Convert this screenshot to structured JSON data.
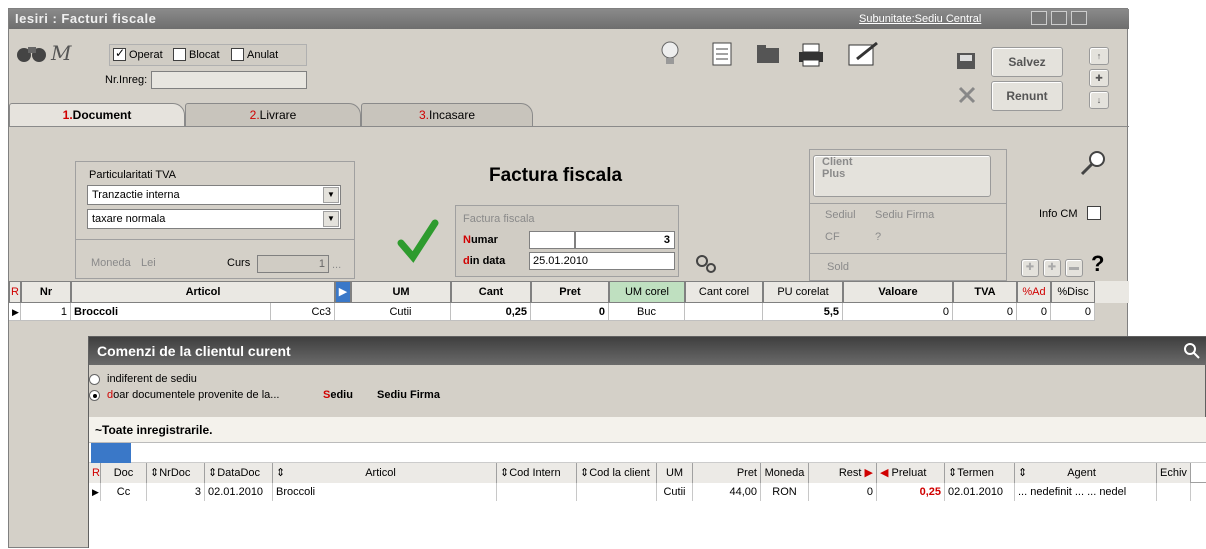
{
  "window": {
    "title": "Iesiri : Facturi fiscale",
    "subunitate": "Subunitate:Sediu Central"
  },
  "toolbar": {
    "m_label": "M",
    "operat_label": "Operat",
    "operat_checked": true,
    "blocat_label": "Blocat",
    "anulat_label": "Anulat",
    "nr_inreg_label": "Nr.Inreg:",
    "nr_inreg_value": "",
    "salvez_label": "Salvez",
    "renunt_label": "Renunt"
  },
  "tabs": [
    {
      "num": "1.",
      "label": "Document",
      "active": true
    },
    {
      "num": "2.",
      "label": "Livrare",
      "active": false
    },
    {
      "num": "3.",
      "label": "Incasare",
      "active": false
    }
  ],
  "tva": {
    "title": "Particularitati TVA",
    "combo1": "Tranzactie interna",
    "combo2": "taxare normala",
    "moneda_label": "Moneda",
    "moneda_value": "Lei",
    "curs_label": "Curs",
    "curs_value": "1",
    "curs_ellipsis": "..."
  },
  "document": {
    "heading": "Factura fiscala",
    "box_label": "Factura fiscala",
    "numar_label_first": "N",
    "numar_label_rest": "umar",
    "numar_series": "",
    "numar_value": "3",
    "data_label_first": "d",
    "data_label_rest": "in data",
    "data_value": "25.01.2010"
  },
  "client": {
    "button_label_1": "Client",
    "button_label_2": "Plus",
    "sediul_label": "Sediul",
    "sediul_value": "Sediu Firma",
    "cf_label": "CF",
    "cf_value": "?",
    "sold_label": "Sold",
    "info_cm_label": "Info CM",
    "help": "?"
  },
  "grid": {
    "columns": {
      "r": "R",
      "nr": "Nr",
      "articol": "Articol",
      "um": "UM",
      "cant": "Cant",
      "pret": "Pret",
      "um_corel": "UM corel",
      "cant_corel": "Cant corel",
      "pu_corelat": "PU corelat",
      "valoare": "Valoare",
      "tva": "TVA",
      "ad": "%Ad",
      "disc": "%Disc"
    },
    "row": {
      "nr": "1",
      "articol": "Broccoli",
      "cod": "Cc3",
      "um": "Cutii",
      "cant": "0,25",
      "pret": "0",
      "um_corel": "Buc",
      "cant_corel": "",
      "pu_corelat": "5,5",
      "valoare": "0",
      "tva": "0",
      "ad": "0",
      "disc": "0"
    }
  },
  "comenzi": {
    "title": "Comenzi de la clientul curent",
    "opt1": "indiferent de sediu",
    "opt2_first": "d",
    "opt2_rest": "oar documentele provenite de la...",
    "sediu_label_first": "S",
    "sediu_label_rest": "ediu",
    "sediu_value": "Sediu Firma",
    "filter_label": "~Toate inregistrarile.",
    "columns": {
      "r": "R",
      "doc": "Doc",
      "nrdoc": "NrDoc",
      "datadoc": "DataDoc",
      "articol": "Articol",
      "cod_intern": "Cod Intern",
      "cod_client": "Cod la client",
      "um": "UM",
      "pret": "Pret",
      "moneda": "Moneda",
      "rest": "Rest",
      "preluat": "Preluat",
      "termen": "Termen",
      "agent": "Agent",
      "echiv": "Echiv"
    },
    "row": {
      "doc": "Cc",
      "nrdoc": "3",
      "datadoc": "02.01.2010",
      "articol": "Broccoli",
      "cod_intern": "",
      "cod_client": "",
      "um": "Cutii",
      "pret": "44,00",
      "moneda": "RON",
      "rest": "0",
      "preluat": "0,25",
      "termen": "02.01.2010",
      "agent": "... nedefinit ... ... nedel"
    }
  },
  "colors": {
    "accent_red": "#d00000",
    "check_green": "#2e9b2e",
    "title_gray": "#6e6e6e"
  }
}
